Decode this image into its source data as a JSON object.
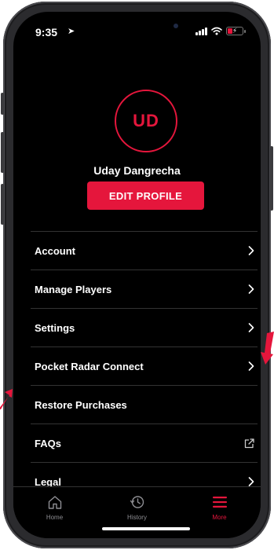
{
  "status_bar": {
    "time": "9:35",
    "location_glyph": "➤"
  },
  "profile": {
    "initials": "UD",
    "name": "Uday Dangrecha",
    "edit_label": "EDIT PROFILE"
  },
  "menu": {
    "items": [
      {
        "label": "Account",
        "icon": "chevron-right-icon"
      },
      {
        "label": "Manage Players",
        "icon": "chevron-right-icon"
      },
      {
        "label": "Settings",
        "icon": "chevron-right-icon"
      },
      {
        "label": "Pocket Radar Connect",
        "icon": "chevron-right-icon"
      },
      {
        "label": "Restore Purchases",
        "icon": ""
      },
      {
        "label": "FAQs",
        "icon": "external-link-icon"
      },
      {
        "label": "Legal",
        "icon": "chevron-right-icon"
      }
    ]
  },
  "tab_bar": {
    "active": "More",
    "tabs": [
      {
        "label": "Home",
        "icon": "home-icon"
      },
      {
        "label": "History",
        "icon": "history-icon"
      },
      {
        "label": "More",
        "icon": "hamburger-menu-icon"
      }
    ]
  },
  "colors": {
    "accent": "#e5163c",
    "background": "#000000",
    "divider": "#333333",
    "inactive": "#8e8e93"
  },
  "battery": {
    "charge_fraction": 0.3,
    "charging": true
  }
}
